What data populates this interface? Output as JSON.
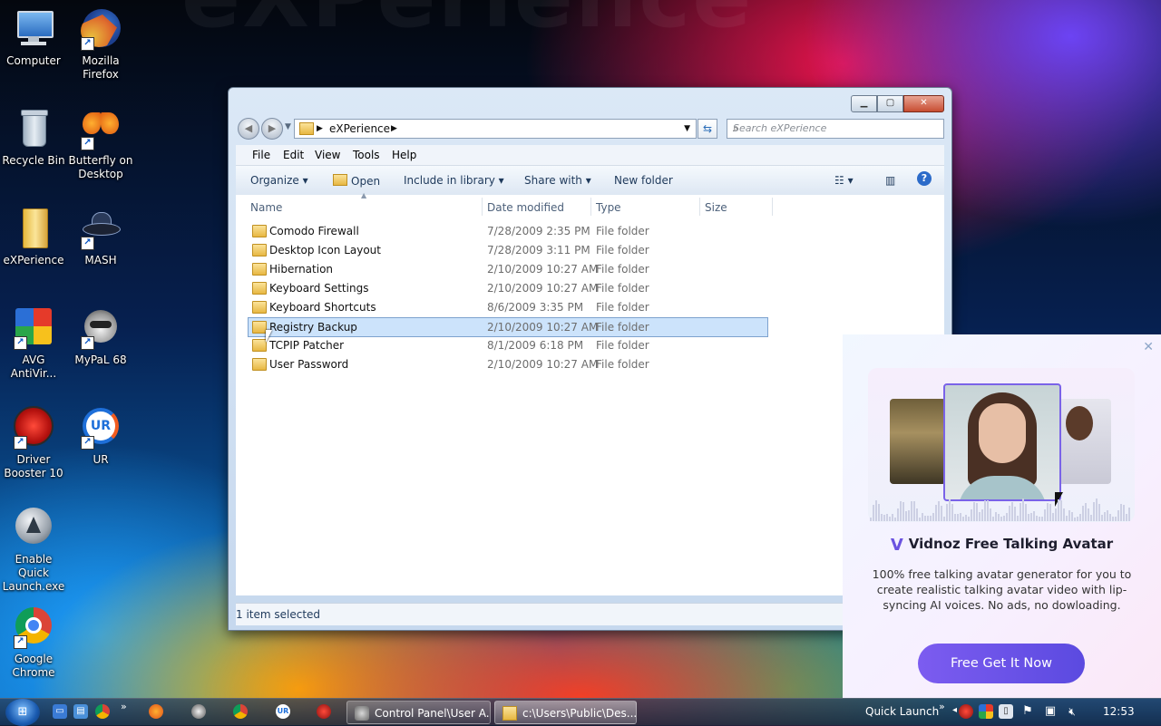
{
  "desktop": {
    "icons": [
      {
        "label": "Computer"
      },
      {
        "label": "Mozilla Firefox"
      },
      {
        "label": "Recycle Bin"
      },
      {
        "label": "Butterfly on Desktop"
      },
      {
        "label": "eXPerience"
      },
      {
        "label": "MASH"
      },
      {
        "label": "AVG AntiVir..."
      },
      {
        "label": "MyPaL 68"
      },
      {
        "label": "Driver Booster 10"
      },
      {
        "label": "UR"
      },
      {
        "label": "Enable Quick Launch.exe"
      },
      {
        "label": "Google Chrome"
      }
    ]
  },
  "explorer": {
    "breadcrumb": [
      "eXPerience"
    ],
    "search_placeholder": "Search eXPerience",
    "menu": [
      "File",
      "Edit",
      "View",
      "Tools",
      "Help"
    ],
    "toolbar": {
      "organize": "Organize",
      "open": "Open",
      "include": "Include in library",
      "share": "Share with",
      "new_folder": "New folder"
    },
    "columns": [
      "Name",
      "Date modified",
      "Type",
      "Size"
    ],
    "rows": [
      {
        "name": "Comodo Firewall",
        "date": "7/28/2009 2:35 PM",
        "type": "File folder"
      },
      {
        "name": "Desktop Icon Layout",
        "date": "7/28/2009 3:11 PM",
        "type": "File folder"
      },
      {
        "name": "Hibernation",
        "date": "2/10/2009 10:27 AM",
        "type": "File folder"
      },
      {
        "name": "Keyboard Settings",
        "date": "2/10/2009 10:27 AM",
        "type": "File folder"
      },
      {
        "name": "Keyboard Shortcuts",
        "date": "8/6/2009 3:35 PM",
        "type": "File folder"
      },
      {
        "name": "Registry Backup",
        "date": "2/10/2009 10:27 AM",
        "type": "File folder"
      },
      {
        "name": "TCPIP Patcher",
        "date": "8/1/2009 6:18 PM",
        "type": "File folder"
      },
      {
        "name": "User Password",
        "date": "2/10/2009 10:27 AM",
        "type": "File folder"
      }
    ],
    "selected_row": "Registry Backup",
    "status": "1 item selected"
  },
  "popup": {
    "title": "Vidnoz Free Talking Avatar",
    "description": "100% free talking avatar generator for you to create realistic talking avatar video with lip-syncing AI voices. No ads, no dowloading.",
    "cta": "Free Get It Now",
    "close_glyph": "✕"
  },
  "taskbar": {
    "windows": [
      {
        "title": "Control Panel\\User A..."
      },
      {
        "title": "c:\\Users\\Public\\Des..."
      }
    ],
    "quick_launch": "Quick Launch",
    "clock": "12:53"
  },
  "colors": {
    "accent": "#6b53e0",
    "selection": "#cce3fb"
  }
}
